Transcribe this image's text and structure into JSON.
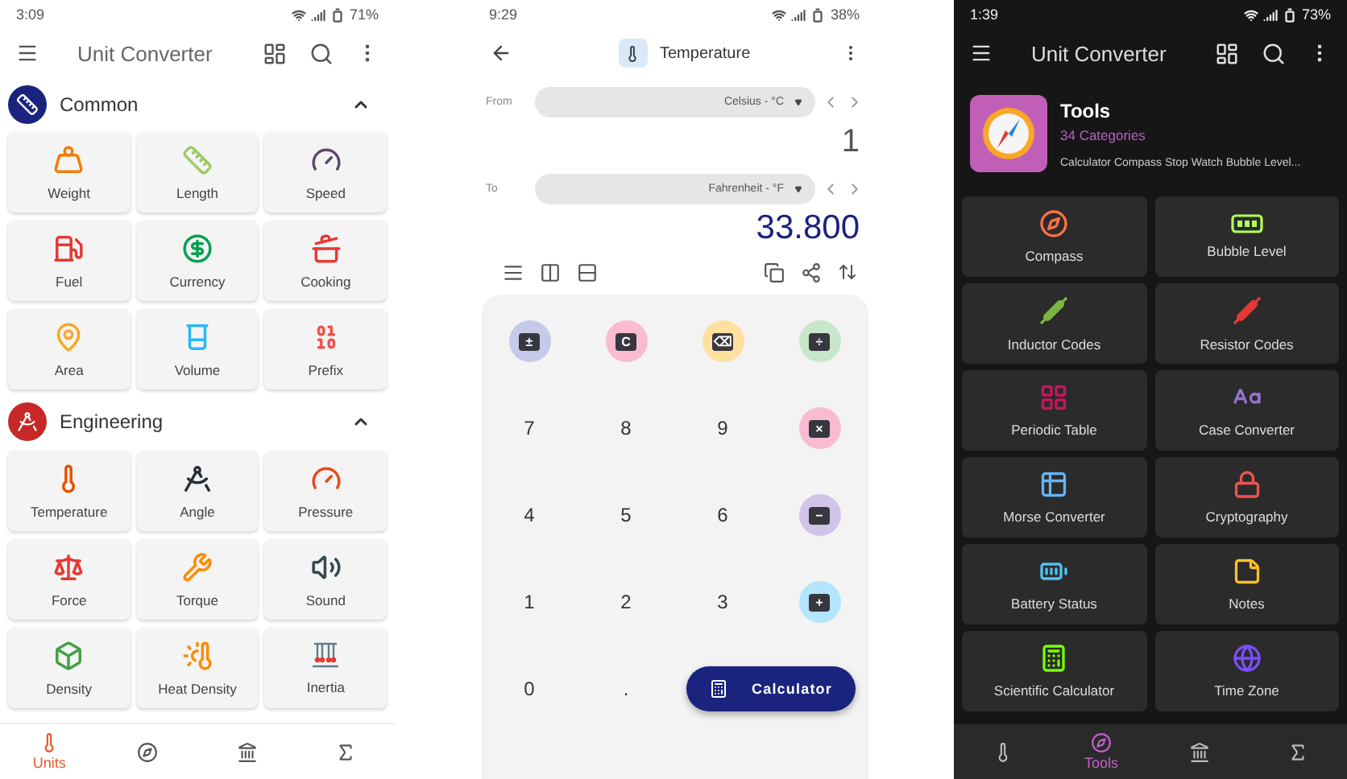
{
  "units_screen": {
    "status_bar": {
      "time": "3:09",
      "battery": "71%"
    },
    "app_bar": {
      "title": "Unit Converter"
    },
    "sections": [
      {
        "title": "Common",
        "expanded": true,
        "items": [
          "Weight",
          "Length",
          "Speed",
          "Fuel",
          "Currency",
          "Cooking",
          "Area",
          "Volume",
          "Prefix"
        ]
      },
      {
        "title": "Engineering",
        "expanded": true,
        "items": [
          "Temperature",
          "Angle",
          "Pressure",
          "Force",
          "Torque",
          "Sound",
          "Density",
          "Heat Density",
          "Inertia"
        ]
      }
    ],
    "bottom_nav": [
      {
        "label": "Units",
        "selected": true
      },
      {
        "selected": false
      },
      {
        "selected": false
      },
      {
        "selected": false
      }
    ]
  },
  "converter_screen": {
    "status_bar": {
      "time": "9:29",
      "battery": "38%"
    },
    "app_bar": {
      "title": "Temperature"
    },
    "from": {
      "label": "From",
      "unit": "Celsius - °C",
      "value": "1"
    },
    "to": {
      "label": "To",
      "unit": "Fahrenheit - °F",
      "value": "33.800"
    },
    "keys": [
      {
        "kind": "op",
        "symbol": "±",
        "color": "#c5cae9"
      },
      {
        "kind": "op",
        "symbol": "C",
        "color": "#f8bbd0"
      },
      {
        "kind": "op",
        "symbol": "⌫",
        "color": "#ffe0a0"
      },
      {
        "kind": "op",
        "symbol": "÷",
        "color": "#c8e6c9"
      },
      {
        "kind": "digit",
        "symbol": "7"
      },
      {
        "kind": "digit",
        "symbol": "8"
      },
      {
        "kind": "digit",
        "symbol": "9"
      },
      {
        "kind": "op",
        "symbol": "×",
        "color": "#f8bbd0"
      },
      {
        "kind": "digit",
        "symbol": "4"
      },
      {
        "kind": "digit",
        "symbol": "5"
      },
      {
        "kind": "digit",
        "symbol": "6"
      },
      {
        "kind": "op",
        "symbol": "−",
        "color": "#d1c4e9"
      },
      {
        "kind": "digit",
        "symbol": "1"
      },
      {
        "kind": "digit",
        "symbol": "2"
      },
      {
        "kind": "digit",
        "symbol": "3"
      },
      {
        "kind": "op",
        "symbol": "+",
        "color": "#b3e5fc"
      },
      {
        "kind": "digit",
        "symbol": "0"
      },
      {
        "kind": "digit",
        "symbol": "."
      }
    ],
    "fab": {
      "label": "Calculator"
    }
  },
  "tools_screen": {
    "status_bar": {
      "time": "1:39",
      "battery": "73%"
    },
    "app_bar": {
      "title": "Unit Converter"
    },
    "header": {
      "title": "Tools",
      "subtitle": "34 Categories",
      "description": "Calculator Compass Stop Watch Bubble Level..."
    },
    "items": [
      "Compass",
      "Bubble Level",
      "Inductor Codes",
      "Resistor Codes",
      "Periodic Table",
      "Case Converter",
      "Morse Converter",
      "Cryptography",
      "Battery Status",
      "Notes",
      "Scientific Calculator",
      "Time Zone"
    ],
    "bottom_nav": [
      {
        "selected": false
      },
      {
        "label": "Tools",
        "selected": true
      },
      {
        "selected": false
      },
      {
        "selected": false
      }
    ]
  }
}
